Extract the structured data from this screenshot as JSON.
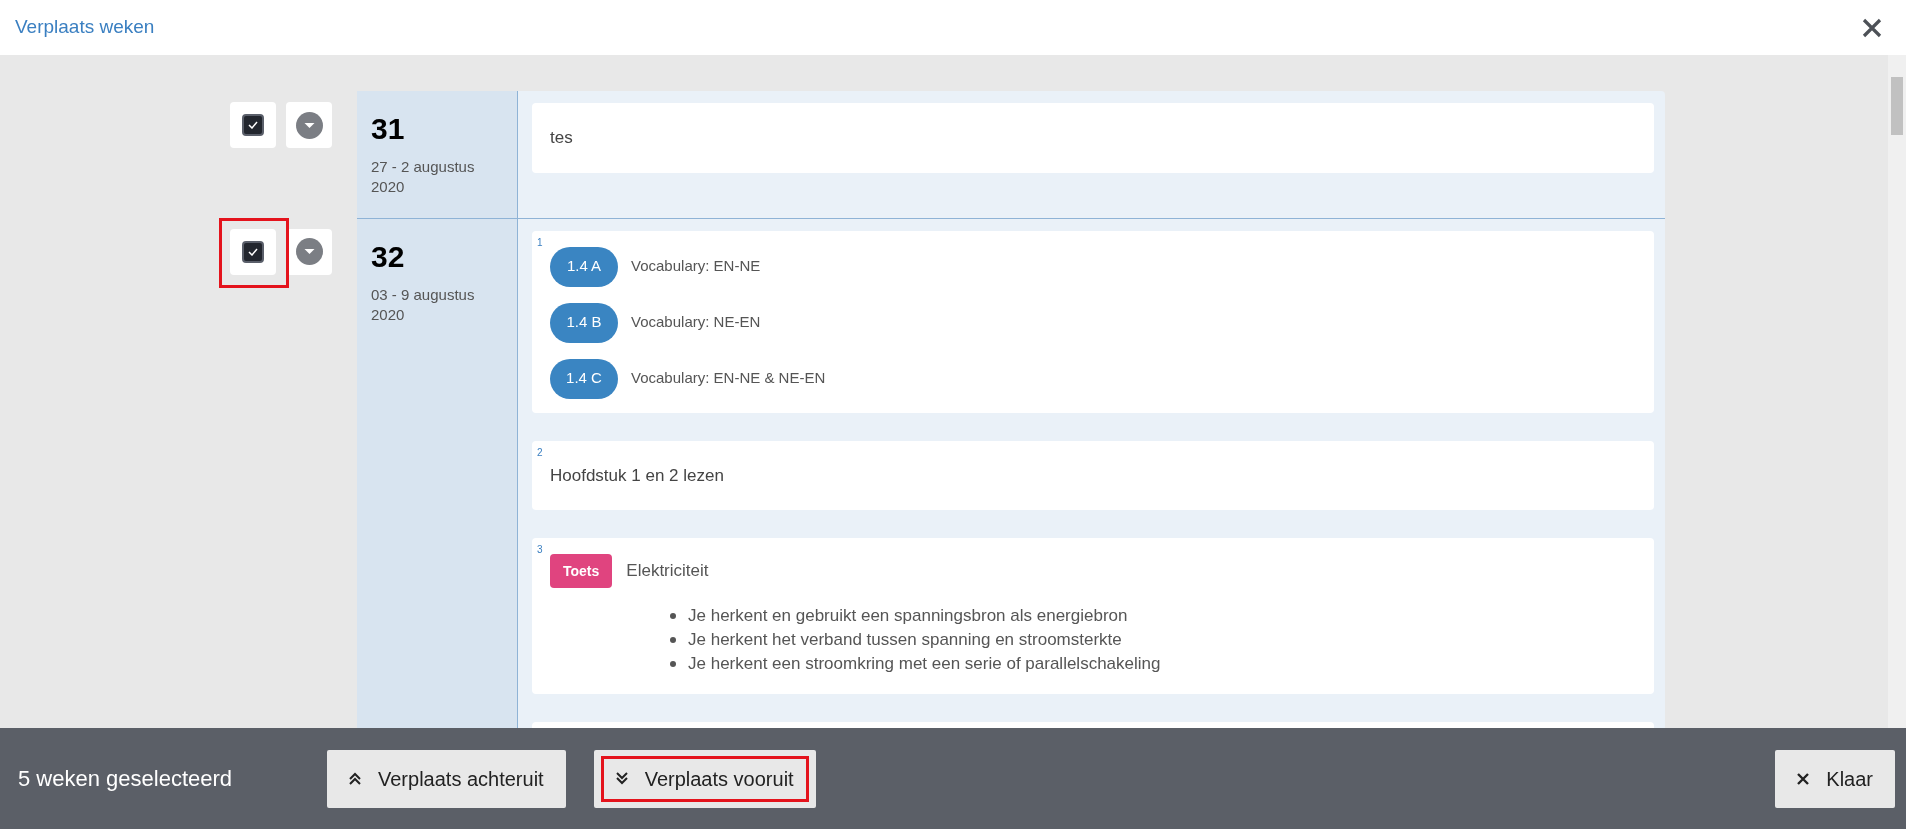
{
  "dialog": {
    "title": "Verplaats weken"
  },
  "weeks": [
    {
      "number": "31",
      "dates": "27 - 2 augustus 2020",
      "checked": true,
      "highlighted": false,
      "items": [
        {
          "kind": "text",
          "text": "tes"
        }
      ]
    },
    {
      "number": "32",
      "dates": "03 - 9 augustus 2020",
      "checked": true,
      "highlighted": true,
      "items": [
        {
          "kind": "lessons",
          "index": "1",
          "lessons": [
            {
              "code": "1.4 A",
              "title": "Vocabulary: EN-NE"
            },
            {
              "code": "1.4 B",
              "title": "Vocabulary: NE-EN"
            },
            {
              "code": "1.4 C",
              "title": "Vocabulary: EN-NE & NE-EN"
            }
          ]
        },
        {
          "kind": "text",
          "index": "2",
          "text": "Hoofdstuk 1 en 2 lezen"
        },
        {
          "kind": "test",
          "index": "3",
          "tag": "Toets",
          "text": "Elektriciteit",
          "bullets": [
            "Je herkent en gebruikt een spanningsbron als energiebron",
            "Je herkent het verband tussen spanning en stroomsterkte",
            "Je herkent een stroomkring met een serie of parallelschakeling"
          ]
        },
        {
          "kind": "empty"
        }
      ]
    }
  ],
  "footer": {
    "selection": "5 weken geselecteerd",
    "buttons": [
      {
        "kind": "back",
        "label": "Verplaats achteruit",
        "highlighted": false
      },
      {
        "kind": "forward",
        "label": "Verplaats vooruit",
        "highlighted": true
      },
      {
        "kind": "done",
        "label": "Klaar",
        "highlighted": false
      }
    ]
  }
}
